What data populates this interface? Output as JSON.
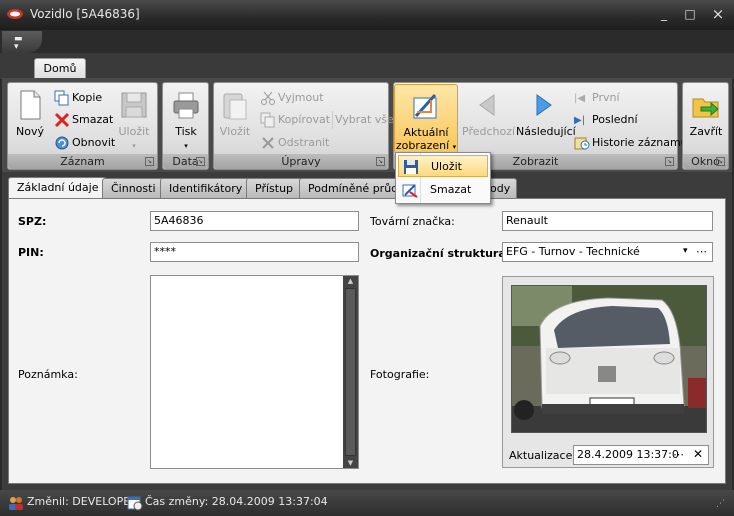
{
  "window": {
    "title": "Vozidlo [5A46836]",
    "minimize": "_",
    "maximize": "□",
    "close": "×"
  },
  "ribbon_tabs": [
    "Domů"
  ],
  "groups": {
    "zaznam": {
      "label": "Záznam",
      "novy": "Nový",
      "kopie": "Kopie",
      "smazat": "Smazat",
      "obnovit": "Obnovit",
      "ulozit": "Uložit"
    },
    "data": {
      "label": "Data",
      "tisk": "Tisk"
    },
    "upravy": {
      "label": "Úpravy",
      "vlozit": "Vložit",
      "vyjmout": "Vyjmout",
      "kopirovat": "Kopírovat",
      "odstranit": "Odstranit",
      "vybrat_vse": "Vybrat vše"
    },
    "zobrazit": {
      "label": "Zobrazit",
      "aktualni_1": "Aktuální",
      "aktualni_2": "zobrazení",
      "predchozi": "Předchozí",
      "nasledujici": "Následující",
      "prvni": "První",
      "posledni": "Poslední",
      "historie": "Historie záznamu"
    },
    "okno": {
      "label": "Okno",
      "zavrit": "Zavřít"
    }
  },
  "dropdown": {
    "ulozit": "Uložit",
    "smazat": "Smazat"
  },
  "doc_tabs": [
    "Základní údaje",
    "Činnosti",
    "Identifikátory",
    "Přístup",
    "Podmíněné průcho",
    "chody"
  ],
  "form": {
    "spz_label": "SPZ:",
    "spz_value": "5A46836",
    "pin_label": "PIN:",
    "pin_value": "****",
    "poznamka_label": "Poznámka:",
    "znacka_label": "Tovární značka:",
    "znacka_value": "Renault",
    "org_label": "Organizační struktura:",
    "org_value": "EFG - Turnov - Technické",
    "foto_label": "Fotografie:",
    "aktualizace_label": "Aktualizace:",
    "aktualizace_value": "28.4.2009 13:37:0"
  },
  "status": {
    "zmenil": "Změnil: DEVELOPER",
    "cas": "Čas změny: 28.04.2009 13:37:04"
  },
  "colors": {
    "accent": "#f9c65a",
    "chrome": "#3a3a3a"
  }
}
